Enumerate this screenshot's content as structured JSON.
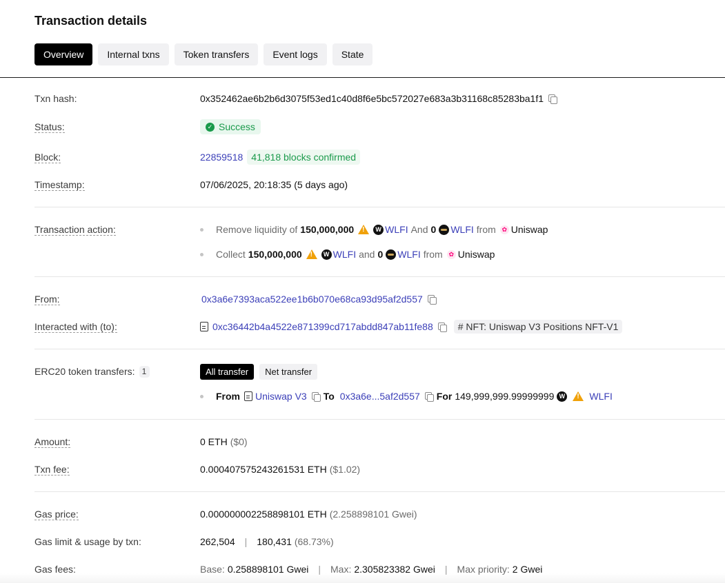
{
  "page_title": "Transaction details",
  "tabs": [
    {
      "label": "Overview",
      "active": true
    },
    {
      "label": "Internal txns",
      "active": false
    },
    {
      "label": "Token transfers",
      "active": false
    },
    {
      "label": "Event logs",
      "active": false
    },
    {
      "label": "State",
      "active": false
    }
  ],
  "txn_hash": {
    "label": "Txn hash:",
    "value": "0x352462ae6b2b6d3075f53ed1c40d8f6e5bc572027e683a3b31168c85283ba1f1"
  },
  "status": {
    "label": "Status:",
    "value": "Success",
    "color": "#1a9a4b"
  },
  "block": {
    "label": "Block:",
    "number": "22859518",
    "confirmations": "41,818 blocks confirmed"
  },
  "timestamp": {
    "label": "Timestamp:",
    "value": "07/06/2025, 20:18:35 (5 days ago)"
  },
  "txn_action": {
    "label": "Transaction action:",
    "line1": {
      "verb": "Remove liquidity of",
      "amount1": "150,000,000",
      "token1": "WLFI",
      "conj": "And",
      "amount2": "0",
      "token2": "WLFI",
      "from": "from",
      "dex": "Uniswap"
    },
    "line2": {
      "verb": "Collect",
      "amount1": "150,000,000",
      "token1": "WLFI",
      "conj": "and",
      "amount2": "0",
      "token2": "WLFI",
      "from": "from",
      "dex": "Uniswap"
    }
  },
  "from": {
    "label": "From:",
    "address": "0x3a6e7393aca522ee1b6b070e68ca93d95af2d557"
  },
  "interacted_with": {
    "label": "Interacted with (to):",
    "address": "0xc36442b4a4522e871399cd717abdd847ab11fe88",
    "tag": "# NFT: Uniswap V3 Positions NFT-V1"
  },
  "erc20": {
    "label": "ERC20 token transfers:",
    "count": "1",
    "subtabs": [
      "All transfer",
      "Net transfer"
    ],
    "transfer": {
      "from_label": "From",
      "from_name": "Uniswap V3",
      "to_label": "To",
      "to_address": "0x3a6e...5af2d557",
      "for_label": "For",
      "amount": "149,999,999.99999999",
      "token": "WLFI"
    }
  },
  "amount": {
    "label": "Amount:",
    "value": "0 ETH",
    "usd": "($0)"
  },
  "txn_fee": {
    "label": "Txn fee:",
    "value": "0.000407575243261531 ETH",
    "usd": "($1.02)"
  },
  "gas_price": {
    "label": "Gas price:",
    "value": "0.000000002258898101 ETH",
    "gwei": "(2.258898101 Gwei)"
  },
  "gas_limit": {
    "label": "Gas limit & usage by txn:",
    "limit": "262,504",
    "used": "180,431",
    "pct": "(68.73%)"
  },
  "gas_fees": {
    "label": "Gas fees:",
    "base_label": "Base:",
    "base": "0.258898101 Gwei",
    "max_label": "Max:",
    "max": "2.305823382 Gwei",
    "priority_label": "Max priority:",
    "priority": "2 Gwei"
  }
}
